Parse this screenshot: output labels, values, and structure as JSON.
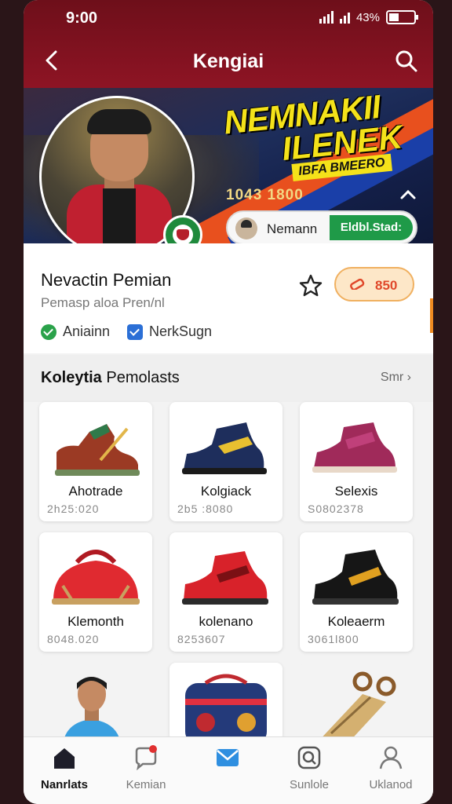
{
  "status": {
    "time": "9:00",
    "battery": "43%"
  },
  "header": {
    "title": "Kengiai",
    "back_icon": "back-arrow-icon",
    "search_icon": "search-icon"
  },
  "banner": {
    "headline_1": "NEMNAKII",
    "headline_2": "ILENEK",
    "headline_3": "IBFA BMEERO",
    "number": "1043 1800",
    "pill_name": "Nemann",
    "pill_button": "Eldbl.Stad:"
  },
  "profile": {
    "name": "Nevactin Pemian",
    "subtitle": "Pemasp aloa Pren/nl",
    "price": "850",
    "chips": [
      {
        "label": "Aniainn",
        "icon": "check-circle-icon"
      },
      {
        "label": "NerkSugn",
        "icon": "verified-icon"
      }
    ]
  },
  "section": {
    "title_bold": "Koleytia",
    "title_rest": "Pemolasts",
    "more": "Smr"
  },
  "items": [
    {
      "name": "Ahotrade",
      "code": "2h25:020",
      "kind": "brown-boot"
    },
    {
      "name": "Kolgiack",
      "code": "2b5 :8080",
      "kind": "navy-sneaker"
    },
    {
      "name": "Selexis",
      "code": "S0802378",
      "kind": "magenta-sneaker"
    },
    {
      "name": "Klemonth",
      "code": "8048.020",
      "kind": "red-bag"
    },
    {
      "name": "kolenano",
      "code": "8253607",
      "kind": "red-sneaker"
    },
    {
      "name": "Koleaerm",
      "code": "3061l800",
      "kind": "black-sneaker"
    },
    {
      "name": "",
      "code": "",
      "kind": "player-photo"
    },
    {
      "name": "",
      "code": "",
      "kind": "patterned-bag"
    },
    {
      "name": "",
      "code": "",
      "kind": "gold-tool"
    }
  ],
  "tabs": [
    {
      "label": "Nanrlats",
      "icon": "home-icon",
      "active": true
    },
    {
      "label": "Kemian",
      "icon": "chat-bubble-icon",
      "active": false
    },
    {
      "label": "",
      "icon": "mail-icon",
      "active": false
    },
    {
      "label": "Sunlole",
      "icon": "scan-icon",
      "active": false
    },
    {
      "label": "Uklanod",
      "icon": "user-icon",
      "active": false
    }
  ],
  "colors": {
    "header": "#8e1424",
    "accent_green": "#1f9a48",
    "accent_orange": "#e0482a"
  }
}
